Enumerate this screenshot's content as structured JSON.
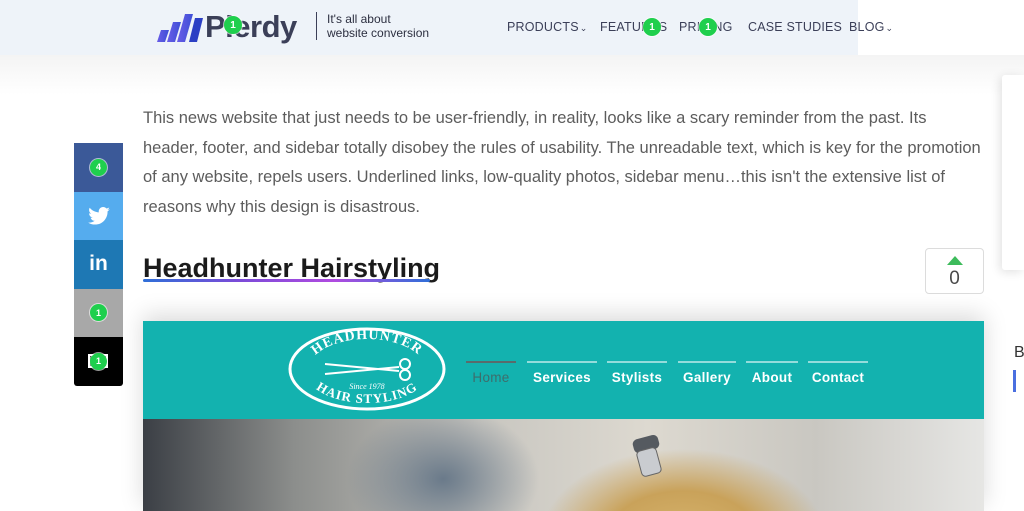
{
  "header": {
    "brand": "Plerdy",
    "tagline_line1": "It's all about",
    "tagline_line2": "website conversion",
    "nav": [
      {
        "label": "PRODUCTS",
        "has_caret": true
      },
      {
        "label": "FEATURES",
        "has_caret": false
      },
      {
        "label": "PRICING",
        "has_caret": false
      },
      {
        "label": "CASE STUDIES",
        "has_caret": false
      },
      {
        "label": "BLOG",
        "has_caret": true
      }
    ],
    "caret_glyph": "⌄"
  },
  "badges": {
    "logo": "1",
    "features": "1",
    "pricing": "1",
    "facebook": "4",
    "pinterest": "1",
    "email": "1"
  },
  "share": {
    "items": [
      "facebook-icon",
      "twitter-icon",
      "linkedin-icon",
      "pinterest-icon",
      "email-icon"
    ],
    "twitter_glyph": "🐦",
    "linkedin_glyph": "in"
  },
  "article": {
    "paragraph": "This news website that just needs to be user-friendly, in reality, looks like a scary reminder from the past. Its header, footer, and sidebar totally disobey the rules of usability. The unreadable text, which is key for the promotion of any website, repels users. Underlined links, low-quality photos, sidebar menu…this isn't the extensive list of reasons why this design is disastrous.",
    "section_title": "Headhunter Hairstyling",
    "vote_count": "0"
  },
  "screenshot": {
    "logo_top": "HEADHUNTER",
    "logo_since": "Since 1978",
    "logo_bottom": "HAIR STYLING",
    "nav": [
      "Home",
      "Services",
      "Stylists",
      "Gallery",
      "About",
      "Contact"
    ],
    "active_index": 0
  },
  "right_edge": {
    "letter": "B"
  },
  "colors": {
    "header_bg": "#eef3f9",
    "badge_green": "#1fcf4d",
    "teal": "#13b2af",
    "facebook": "#3b5998",
    "twitter": "#55acee",
    "linkedin": "#1e78b4"
  }
}
